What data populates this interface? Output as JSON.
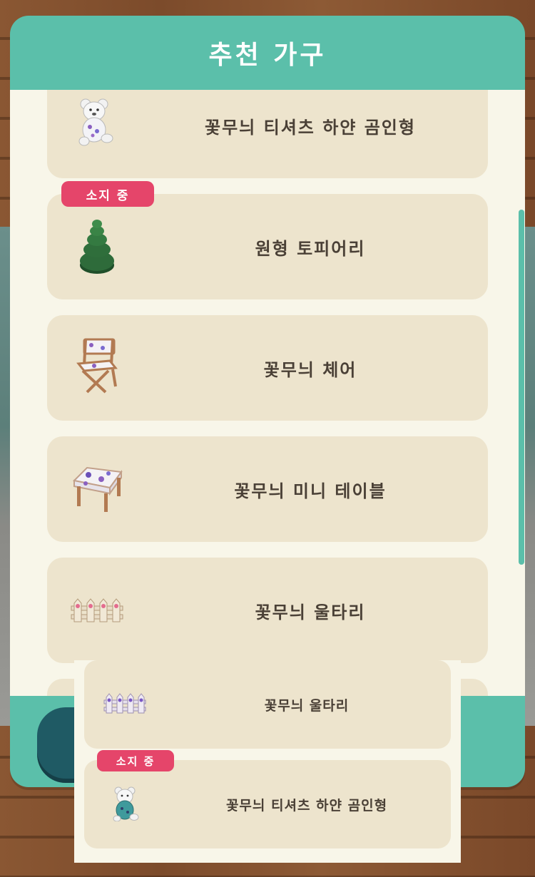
{
  "modal": {
    "title": "추천 가구",
    "accent_color": "#5bbfaa",
    "badge_color": "#e5456a",
    "items": [
      {
        "name": "꽃무늬 티셔츠 하얀 곰인형",
        "owned": false,
        "icon": "white-bear-plush-icon"
      },
      {
        "name": "원형 토피어리",
        "owned": true,
        "badge": "소지 중",
        "icon": "topiary-icon"
      },
      {
        "name": "꽃무늬 체어",
        "owned": false,
        "icon": "director-chair-icon"
      },
      {
        "name": "꽃무늬 미니 테이블",
        "owned": false,
        "icon": "mini-table-icon"
      },
      {
        "name": "꽃무늬 울타리",
        "owned": false,
        "icon": "fence-icon"
      }
    ]
  },
  "popup": {
    "items": [
      {
        "name": "꽃무늬 울타리",
        "owned": false,
        "icon": "purple-fence-icon"
      },
      {
        "name": "꽃무늬 티셔츠 하얀 곰인형",
        "owned": true,
        "badge": "소지 중",
        "icon": "bear-plush-blue-shirt-icon"
      }
    ]
  }
}
